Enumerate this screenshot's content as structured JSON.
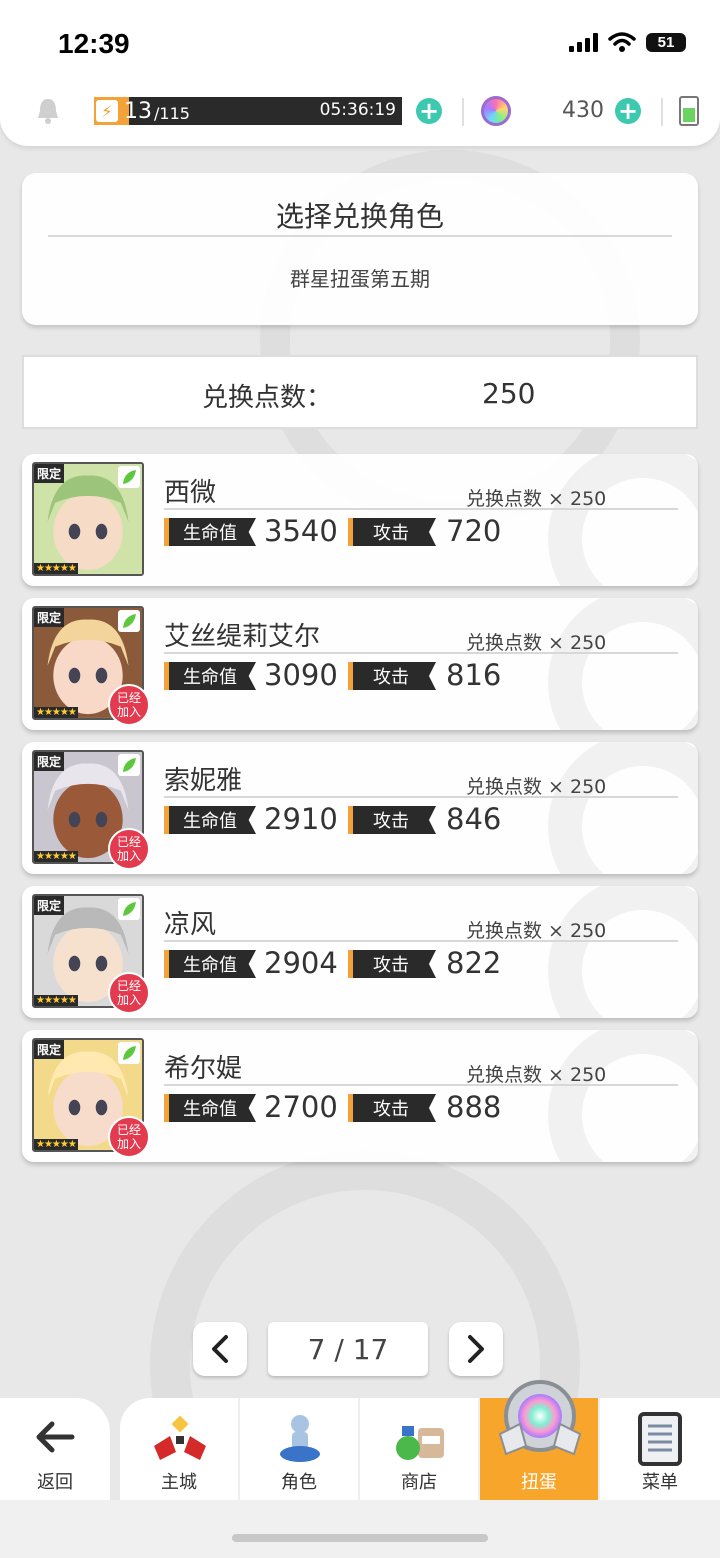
{
  "status_bar": {
    "time": "12:39",
    "battery": "51"
  },
  "resources": {
    "energy_current": "13",
    "energy_max": "/115",
    "energy_fill": 0.113,
    "timer": "05:36:19",
    "gems": "430"
  },
  "header": {
    "title": "选择兑换角色",
    "subtitle": "群星扭蛋第五期"
  },
  "exchange": {
    "label": "兑换点数：",
    "value": "250"
  },
  "stat_labels": {
    "hp": "生命值",
    "atk": "攻击",
    "cost_prefix": "兑换点数 × "
  },
  "characters": [
    {
      "name": "西微",
      "cost": "250",
      "hp": "3540",
      "atk": "720",
      "joined": false,
      "portrait_colors": [
        "#cfe3a8",
        "#9cc47a",
        "#f6dcc6"
      ]
    },
    {
      "name": "艾丝缇莉艾尔",
      "cost": "250",
      "hp": "3090",
      "atk": "816",
      "joined": true,
      "portrait_colors": [
        "#8a5a3a",
        "#f3d49a",
        "#f8d9c8"
      ]
    },
    {
      "name": "索妮雅",
      "cost": "250",
      "hp": "2910",
      "atk": "846",
      "joined": true,
      "portrait_colors": [
        "#c9c6cf",
        "#e8e6ec",
        "#9a5a3a"
      ]
    },
    {
      "name": "凉风",
      "cost": "250",
      "hp": "2904",
      "atk": "822",
      "joined": true,
      "portrait_colors": [
        "#d9d9d9",
        "#b9b9b9",
        "#f6e1cf"
      ]
    },
    {
      "name": "希尔媞",
      "cost": "250",
      "hp": "2700",
      "atk": "888",
      "joined": true,
      "portrait_colors": [
        "#f3d98a",
        "#ffe9b0",
        "#f8dccb"
      ]
    }
  ],
  "badges": {
    "limited": "限定",
    "stars": "★★★★★",
    "joined_line1": "已经",
    "joined_line2": "加入"
  },
  "pagination": {
    "current": "7 / 17"
  },
  "nav": {
    "back": "返回",
    "items": [
      {
        "label": "主城",
        "icon": "castle-icon"
      },
      {
        "label": "角色",
        "icon": "character-icon"
      },
      {
        "label": "商店",
        "icon": "shop-icon"
      },
      {
        "label": "扭蛋",
        "icon": "gacha-icon"
      },
      {
        "label": "菜单",
        "icon": "menu-icon"
      }
    ],
    "active_index": 3,
    "accent": "#f7a52b"
  }
}
